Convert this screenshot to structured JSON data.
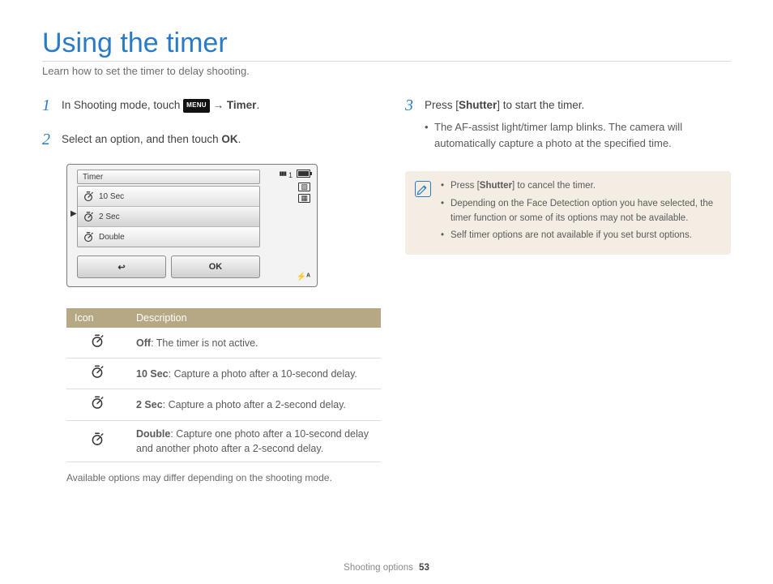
{
  "title": "Using the timer",
  "subtitle": "Learn how to set the timer to delay shooting.",
  "steps": {
    "s1a": "In Shooting mode, touch ",
    "s1_menu": "MENU",
    "s1_arrow": " → ",
    "s1_timer": "Timer",
    "s2a": "Select an option, and then touch ",
    "s2_ok": "OK",
    "s3a": "Press [",
    "s3_shutter": "Shutter",
    "s3b": "] to start the timer.",
    "s3_sub": "The AF-assist light/timer lamp blinks. The camera will automatically capture a photo at the specified time."
  },
  "notes": {
    "n1a": "Press [",
    "n1b": "Shutter",
    "n1c": "] to cancel the timer.",
    "n2": "Depending on the Face Detection option you have selected, the timer function or some of its options may not be available.",
    "n3": "Self timer options are not available if you set burst options."
  },
  "cam": {
    "title": "Timer",
    "r1": "10 Sec",
    "r2": "2 Sec",
    "r3": "Double",
    "back": "↩",
    "ok": "OK",
    "one": "1"
  },
  "table": {
    "h1": "Icon",
    "h2": "Description",
    "r1b": "Off",
    "r1t": ": The timer is not active.",
    "r2b": "10 Sec",
    "r2t": ": Capture a photo after a 10-second delay.",
    "r3b": "2 Sec",
    "r3t": ": Capture a photo after a 2-second delay.",
    "r4b": "Double",
    "r4t": ": Capture one photo after a 10-second delay and another photo after a 2-second delay."
  },
  "caption": "Available options may differ depending on the shooting mode.",
  "footer_section": "Shooting options",
  "footer_page": "53"
}
